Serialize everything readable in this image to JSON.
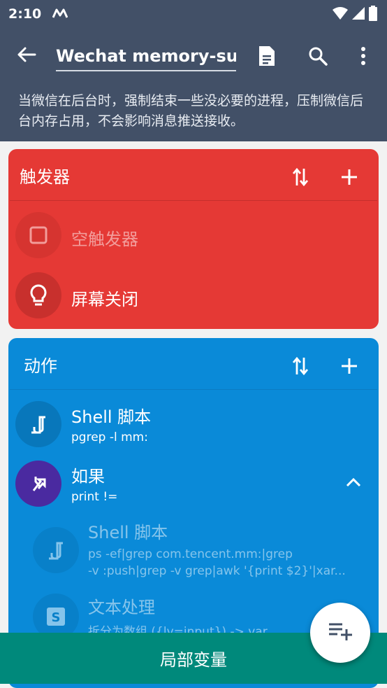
{
  "status_bar": {
    "time": "2:10",
    "icons": [
      "notification-m-icon",
      "wifi-icon",
      "signal-icon",
      "battery-icon"
    ]
  },
  "app_bar": {
    "title_value": "Wechat memory-support",
    "description": "当微信在后台时，强制结束一些没必要的进程，压制微信后台内存占用，不会影响消息推送接收。",
    "icons": [
      "back-arrow-icon",
      "document-icon",
      "search-icon",
      "more-vert-icon"
    ]
  },
  "trigger_card": {
    "title": "触发器",
    "color": "#e53935",
    "items": [
      {
        "label": "空触发器",
        "icon": "checkbox-icon",
        "disabled": true
      },
      {
        "label": "屏幕关闭",
        "icon": "lightbulb-icon",
        "disabled": false
      }
    ]
  },
  "action_card": {
    "title": "动作",
    "color": "#0a8ad8",
    "items": [
      {
        "label": "Shell 脚本",
        "sub": "pgrep -l mm:",
        "icon": "shell-script-icon"
      },
      {
        "label": "如果",
        "sub": "print !=",
        "icon": "branch-icon",
        "expanded": true
      },
      {
        "label": "Shell 脚本",
        "sub1": "ps -ef|grep com.tencent.mm:|grep",
        "sub2": "-v :push|grep -v grep|awk '{print $2}'|xar...",
        "icon": "shell-script-icon",
        "nested": true
      },
      {
        "label": "文本处理",
        "sub": "拆分为数组 ({lv=input}) -> var",
        "icon": "text-s-icon",
        "nested": true
      }
    ]
  },
  "bottom_bar": {
    "label": "局部变量",
    "color": "#00897b"
  },
  "fab": {
    "icon": "playlist-add-icon"
  }
}
